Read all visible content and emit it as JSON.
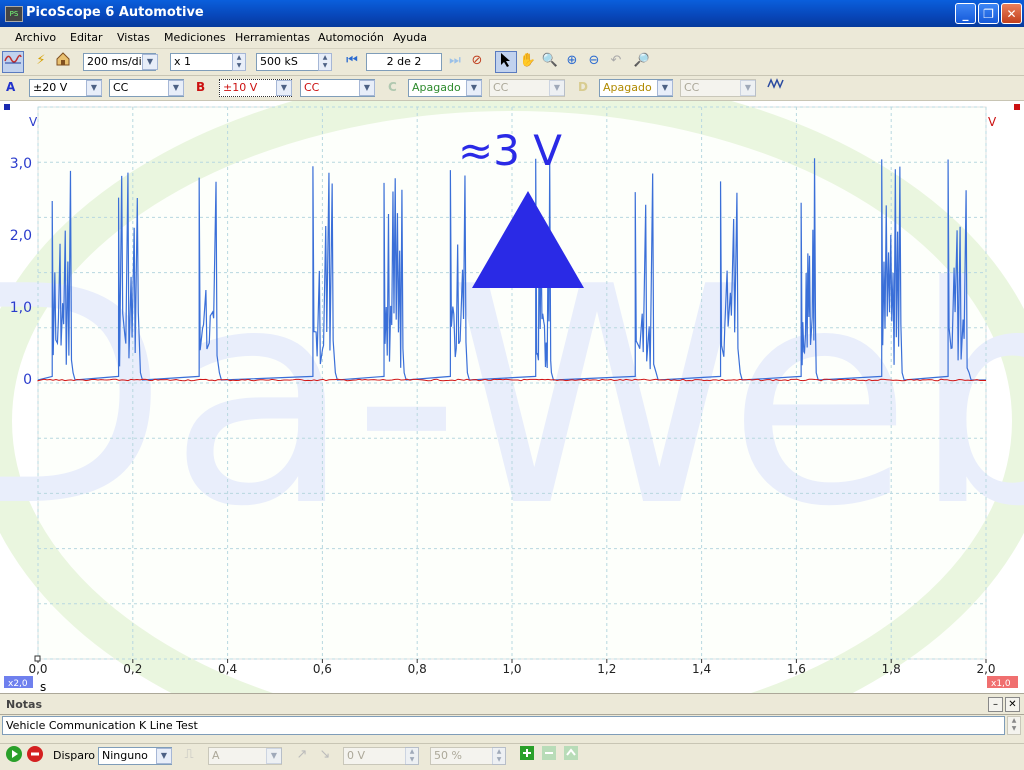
{
  "window": {
    "title": "PicoScope 6 Automotive",
    "app_icon": "PS",
    "minimize": "_",
    "restore": "❐",
    "close": "✕"
  },
  "menu": [
    "Archivo",
    "Editar",
    "Vistas",
    "Mediciones",
    "Herramientas",
    "Automoción",
    "Ayuda"
  ],
  "toolbar": {
    "timebase": "200 ms/div",
    "zoom": "x 1",
    "samples": "500 kS",
    "buffer_current": "2",
    "buffer_of": "de",
    "buffer_total": "2"
  },
  "channels": {
    "a": {
      "label": "A",
      "range": "±20 V",
      "coupling": "CC",
      "color": "#2233cc"
    },
    "b": {
      "label": "B",
      "range": "±10 V",
      "coupling": "CC",
      "color": "#cc1111"
    },
    "c": {
      "label": "C",
      "range": "Apagado",
      "coupling": "CC",
      "color": "#2e8b2e"
    },
    "d": {
      "label": "D",
      "range": "Apagado",
      "coupling": "CC",
      "color": "#c8a000"
    }
  },
  "scope": {
    "annotation": "≈3 V",
    "left_unit": "V",
    "right_unit": "V",
    "y_ticks": [
      {
        "v": 3.0,
        "label": "3,0"
      },
      {
        "v": 2.0,
        "label": "2,0"
      },
      {
        "v": 1.0,
        "label": "1,0"
      },
      {
        "v": 0,
        "label": "0"
      }
    ],
    "x_ticks": [
      "0,0",
      "0,2",
      "0,4",
      "0,6",
      "0,8",
      "1,0",
      "1,2",
      "1,4",
      "1,6",
      "1,8",
      "2,0"
    ],
    "x_unit": "s",
    "left_zoom": "x2,0",
    "right_zoom": "x1,0",
    "watermark": "Da-Web",
    "colors": {
      "channel_a": "#3a6fd8",
      "channel_b": "#d01515",
      "marker": "#2a2ae6",
      "grid": "#b8d8e0"
    }
  },
  "chart_data": {
    "type": "line",
    "xlabel": "s",
    "ylabel": "V",
    "xlim": [
      0,
      2.0
    ],
    "series": [
      {
        "name": "A",
        "burst_times_s": [
          0.03,
          0.17,
          0.34,
          0.58,
          0.73,
          0.87,
          1.05,
          1.26,
          1.44,
          1.61,
          1.78,
          1.92
        ],
        "peak_v": 3.0,
        "baseline_v": 0
      },
      {
        "name": "B",
        "value_v": 0
      }
    ]
  },
  "notes": {
    "title": "Notas",
    "text": "Vehicle Communication K Line Test"
  },
  "trigger": {
    "label": "Disparo",
    "mode": "Ninguno",
    "source": "A",
    "level": "0 V",
    "pretrigger": "50 %"
  }
}
